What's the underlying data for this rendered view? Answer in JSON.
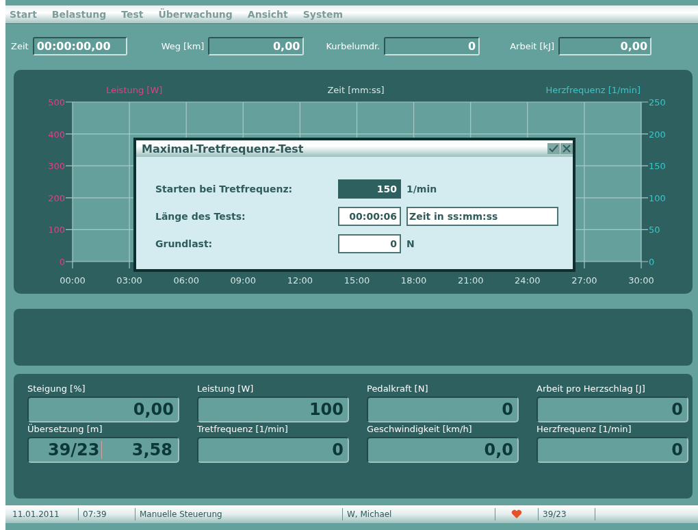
{
  "menu": [
    "Start",
    "Belastung",
    "Test",
    "Überwachung",
    "Ansicht",
    "System"
  ],
  "readouts": [
    {
      "label": "Zeit",
      "value": "00:00:00,00"
    },
    {
      "label": "Weg [km]",
      "value": "0,00"
    },
    {
      "label": "Kurbelumdr.",
      "value": "0"
    },
    {
      "label": "Arbeit [kJ]",
      "value": "0,00"
    }
  ],
  "chart": {
    "left_label": "Leistung [W]",
    "center_label": "Zeit [mm:ss]",
    "right_label": "Herzfrequenz [1/min]",
    "left_ticks": [
      "500",
      "400",
      "300",
      "200",
      "100",
      "0"
    ],
    "right_ticks": [
      "250",
      "200",
      "150",
      "100",
      "50",
      "0"
    ],
    "x_ticks": [
      "00:00",
      "03:00",
      "06:00",
      "09:00",
      "12:00",
      "15:00",
      "18:00",
      "21:00",
      "24:00",
      "27:00",
      "30:00"
    ]
  },
  "dialog": {
    "title": "Maximal-Tretfrequenz-Test",
    "rows": [
      {
        "label": "Starten bei Tretfrequenz:",
        "value": "150",
        "selected": true,
        "unit": "1/min"
      },
      {
        "label": "Länge des Tests:",
        "value": "00:00:06",
        "selected": false,
        "hint": "Zeit in ss:mm:ss"
      },
      {
        "label": "Grundlast:",
        "value": "0",
        "selected": false,
        "unit": "N"
      }
    ]
  },
  "metrics": [
    {
      "label": "Steigung [%]",
      "values": [
        "0,00"
      ]
    },
    {
      "label": "Leistung [W]",
      "values": [
        "100"
      ]
    },
    {
      "label": "Pedalkraft [N]",
      "values": [
        "0"
      ]
    },
    {
      "label": "Arbeit pro Herzschlag [J]",
      "values": [
        "0"
      ]
    },
    {
      "label": "Übersetzung [m]",
      "values": [
        "39/23",
        "3,58"
      ]
    },
    {
      "label": "Tretfrequenz [1/min]",
      "values": [
        "0"
      ]
    },
    {
      "label": "Geschwindigkeit [km/h]",
      "values": [
        "0,0"
      ]
    },
    {
      "label": "Herzfrequenz [1/min]",
      "values": [
        "0"
      ]
    }
  ],
  "status_bar": [
    {
      "kind": "text",
      "text": "11.01.2011"
    },
    {
      "kind": "text",
      "text": "07:39"
    },
    {
      "kind": "text",
      "text": "Manuelle Steuerung"
    },
    {
      "kind": "text",
      "text": "W, Michael"
    },
    {
      "kind": "heart"
    },
    {
      "kind": "text",
      "text": "39/23"
    }
  ]
}
